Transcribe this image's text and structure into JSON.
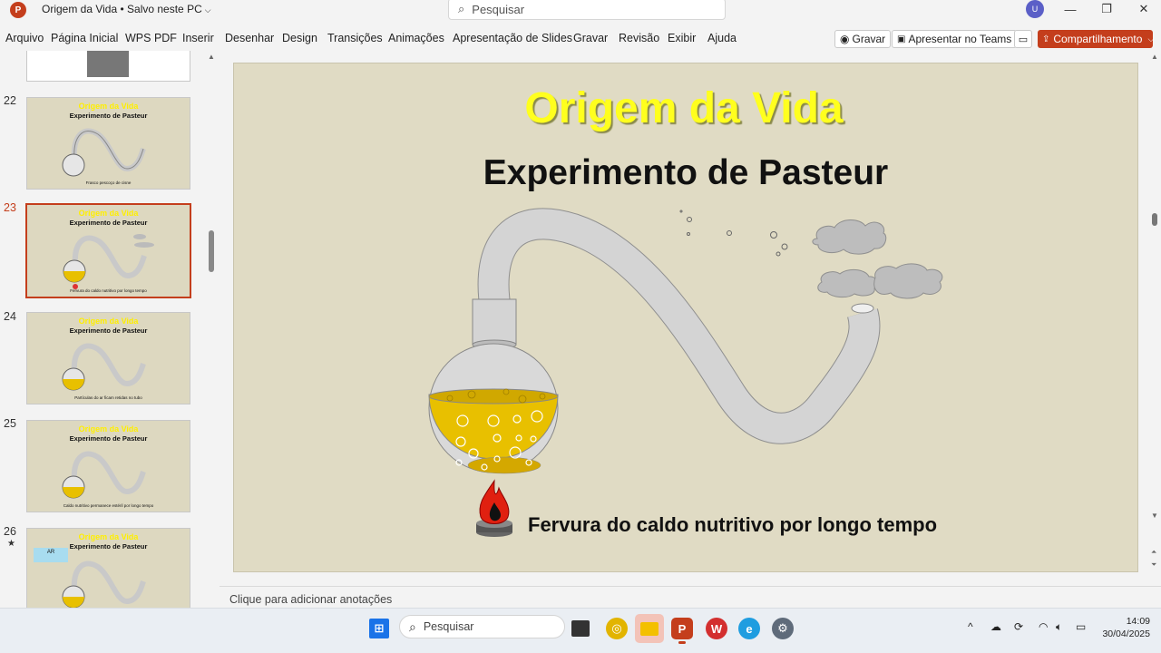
{
  "window": {
    "app_badge": "P",
    "doc_title": "Origem da Vida • Salvo neste PC",
    "search_placeholder": "Pesquisar",
    "avatar_initial": "U"
  },
  "ribbon": {
    "tabs": [
      "Arquivo",
      "Página Inicial",
      "WPS PDF",
      "Inserir",
      "Desenhar",
      "Design",
      "Transições",
      "Animações",
      "Apresentação de Slides",
      "Gravar",
      "Revisão",
      "Exibir",
      "Ajuda"
    ],
    "record_label": "Gravar",
    "teams_label": "Apresentar no Teams",
    "share_label": "Compartilhamento"
  },
  "thumbnails": {
    "items": [
      {
        "number": "22",
        "title": "Origem da Vida",
        "subtitle": "Experimento de Pasteur",
        "caption": "Frasco pescoço de cisne"
      },
      {
        "number": "23",
        "title": "Origem da Vida",
        "subtitle": "Experimento de Pasteur",
        "caption": "Fervura do caldo nutritivo por longo tempo"
      },
      {
        "number": "24",
        "title": "Origem da Vida",
        "subtitle": "Experimento de Pasteur",
        "caption": "Partículas do ar ficam retidas no tubo"
      },
      {
        "number": "25",
        "title": "Origem da Vida",
        "subtitle": "Experimento de Pasteur",
        "caption": "Caldo nutritivo permanece estéril por longo tempo"
      },
      {
        "number": "26",
        "title": "Origem da Vida",
        "subtitle": "Experimento de Pasteur",
        "caption": "",
        "badge": "AR"
      }
    ],
    "selected_index": 1
  },
  "slide": {
    "title": "Origem da Vida",
    "subtitle": "Experimento de Pasteur",
    "caption": "Fervura do caldo nutritivo por longo tempo"
  },
  "notes": {
    "placeholder": "Clique para adicionar anotações"
  },
  "taskbar": {
    "search_placeholder": "Pesquisar",
    "time": "14:09",
    "date": "30/04/2025"
  },
  "colors": {
    "accent": "#c43e1c",
    "slide_bg": "#e0dbc4",
    "title_yellow": "#ffff1e",
    "broth": "#e8c000"
  }
}
